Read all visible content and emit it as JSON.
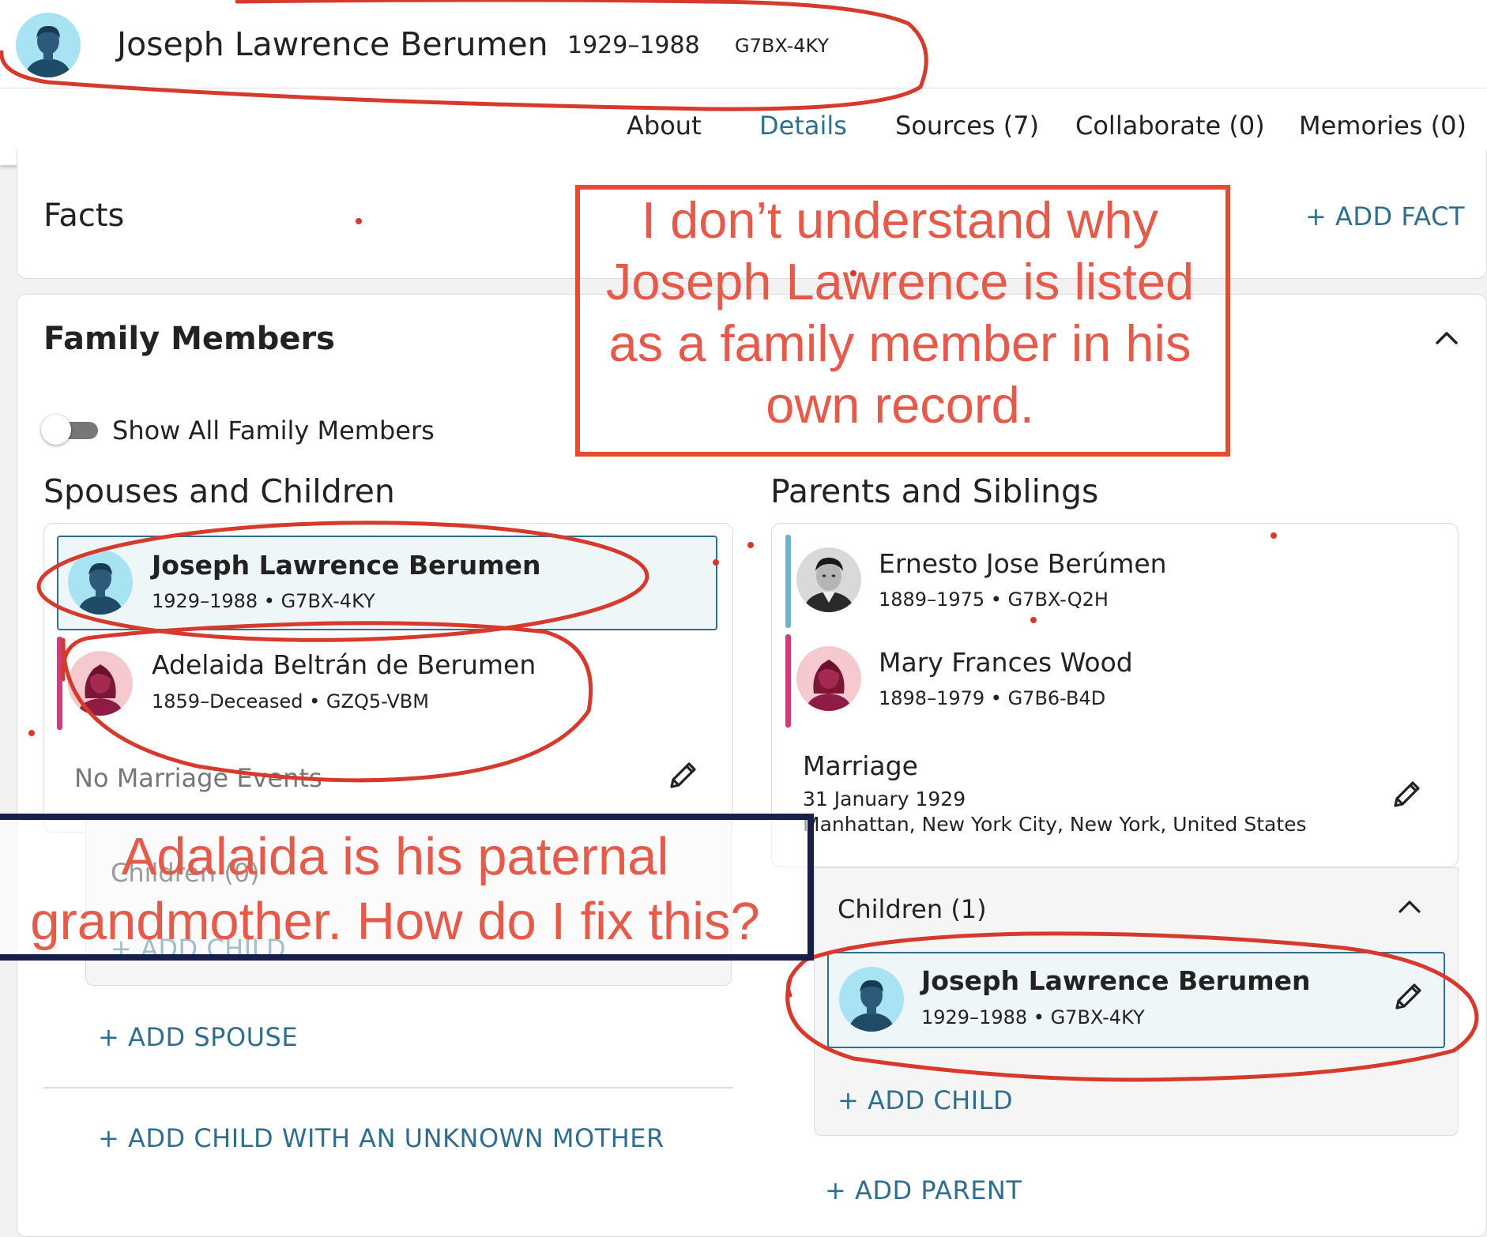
{
  "header": {
    "name": "Joseph Lawrence Berumen",
    "dates": "1929–1988",
    "pid": "G7BX-4KY"
  },
  "tabs": [
    {
      "label": "About"
    },
    {
      "label": "Details",
      "active": true
    },
    {
      "label": "Sources (7)"
    },
    {
      "label": "Collaborate (0)"
    },
    {
      "label": "Memories (0)"
    }
  ],
  "facts": {
    "title": "Facts",
    "add_label": "+  ADD FACT"
  },
  "family": {
    "title": "Family Members",
    "toggle_label": "Show All Family Members",
    "toggle_on": false,
    "spouses": {
      "title": "Spouses and Children",
      "people": [
        {
          "name": "Joseph Lawrence Berumen",
          "meta": "1929–1988 • G7BX-4KY",
          "sex": "male",
          "highlight": true
        },
        {
          "name": "Adelaida Beltrán de Berumen",
          "meta": "1859–Deceased • GZQ5-VBM",
          "sex": "female"
        }
      ],
      "no_marriage": "No Marriage Events",
      "children_label": "Children (0)",
      "add_child": "+  ADD CHILD",
      "add_spouse": "+  ADD SPOUSE",
      "add_child_unknown_mother": "+  ADD CHILD WITH AN UNKNOWN MOTHER"
    },
    "parents": {
      "title": "Parents and Siblings",
      "people": [
        {
          "name": "Ernesto Jose Berúmen",
          "meta": "1889–1975 • G7BX-Q2H",
          "sex": "male"
        },
        {
          "name": "Mary Frances Wood",
          "meta": "1898–1979 • G7B6-B4D",
          "sex": "female"
        }
      ],
      "marriage_label": "Marriage",
      "marriage_date": "31 January 1929",
      "marriage_place": "Manhattan, New York City, New York, United States",
      "children_label": "Children (1)",
      "children": [
        {
          "name": "Joseph Lawrence Berumen",
          "meta": "1929–1988 • G7BX-4KY",
          "sex": "male"
        }
      ],
      "add_child": "+  ADD CHILD",
      "add_parent": "+  ADD PARENT"
    }
  },
  "annotations": {
    "note1": [
      "I don’t understand why",
      "Joseph Lawrence is listed",
      "as a family member in his",
      "own record."
    ],
    "note2": [
      "Adalaida is his paternal",
      "grandmother. How do I fix this?"
    ],
    "red": "#e65a4a",
    "navy": "#16204a"
  },
  "colors": {
    "accent": "#2f6f8d",
    "male": "#6fb1c9",
    "female": "#c9407a"
  }
}
